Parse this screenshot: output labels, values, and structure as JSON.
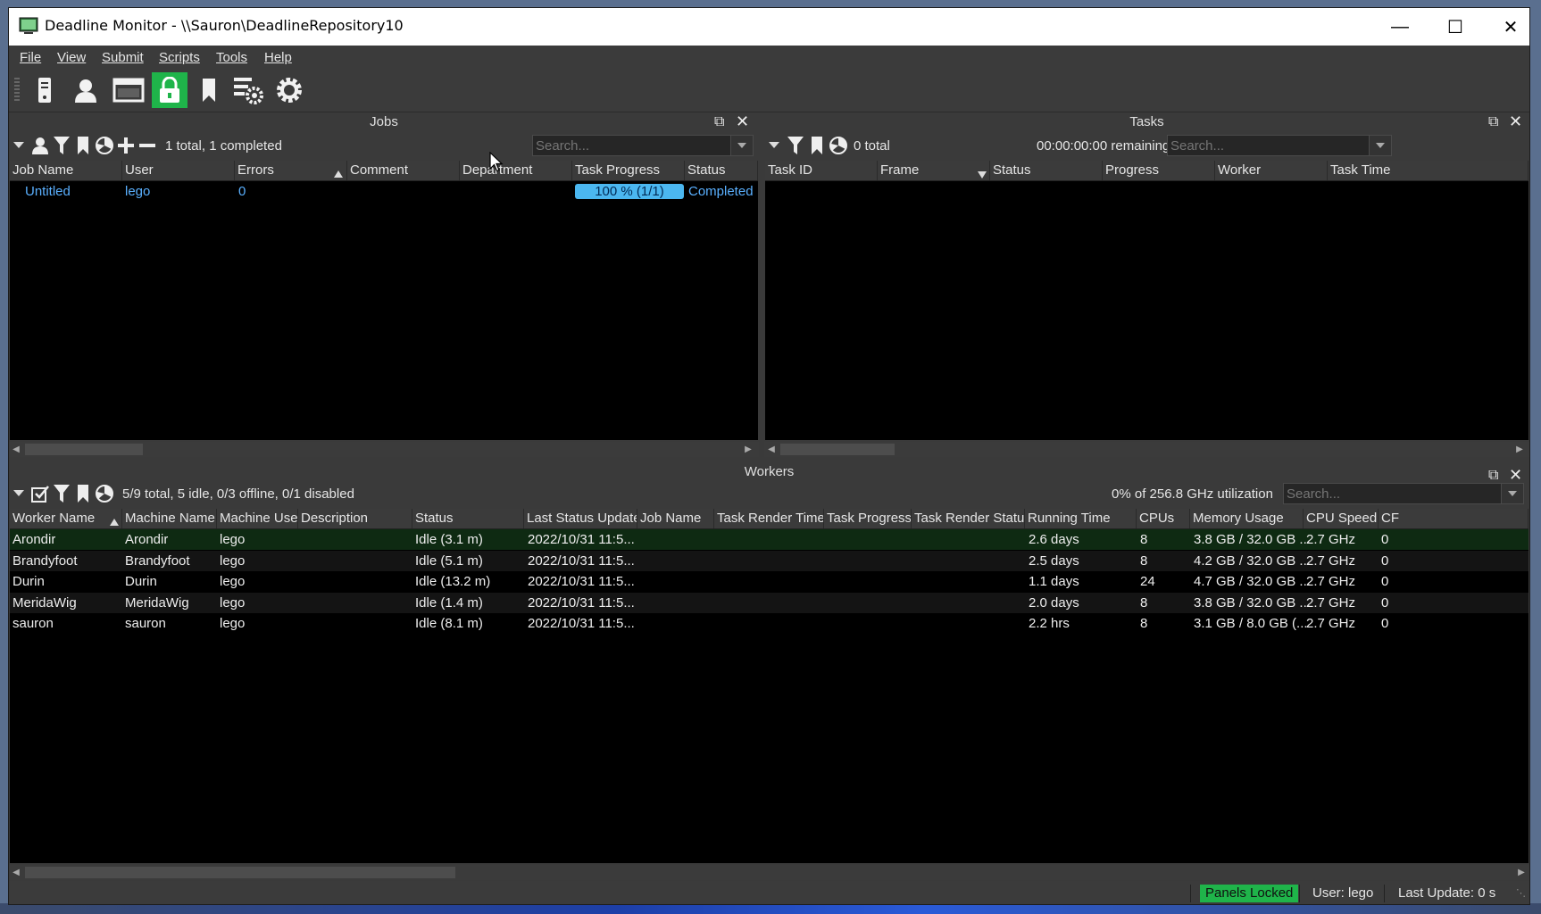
{
  "window": {
    "title": "Deadline Monitor  -  \\\\Sauron\\DeadlineRepository10"
  },
  "menu": [
    "File",
    "View",
    "Submit",
    "Scripts",
    "Tools",
    "Help"
  ],
  "toolbar_icons": [
    "worker-icon",
    "user-icon",
    "monitor-icon",
    "lock-icon",
    "bookmark-icon",
    "settings-list-icon",
    "gear-icon"
  ],
  "jobs": {
    "title": "Jobs",
    "summary": "1 total, 1 completed",
    "search_placeholder": "Search...",
    "columns": [
      "Job Name",
      "User",
      "Errors",
      "Comment",
      "Department",
      "Task Progress",
      "Status"
    ],
    "rows": [
      {
        "job_name": "Untitled",
        "user": "lego",
        "errors": "0",
        "comment": "",
        "department": "",
        "task_progress": "100 %  (1/1)",
        "progress_fraction": 1.0,
        "status": "Completed"
      }
    ]
  },
  "tasks": {
    "title": "Tasks",
    "summary": "0 total",
    "remaining": "00:00:00:00 remaining",
    "search_placeholder": "Search...",
    "columns": [
      "Task ID",
      "Frame",
      "Status",
      "Progress",
      "Worker",
      "Task Time"
    ]
  },
  "workers": {
    "title": "Workers",
    "summary": "5/9 total, 5 idle, 0/3 offline, 0/1 disabled",
    "utilization": "0% of 256.8 GHz utilization",
    "search_placeholder": "Search...",
    "columns": [
      "Worker Name",
      "Machine Name",
      "Machine User",
      "Description",
      "Status",
      "Last Status Update",
      "Job Name",
      "Task Render Time",
      "Task Progress",
      "Task Render Status",
      "Running Time",
      "CPUs",
      "Memory Usage",
      "CPU Speed",
      "CF"
    ],
    "rows": [
      {
        "name": "Arondir",
        "machine": "Arondir",
        "user": "lego",
        "status": "Idle (3.1 m)",
        "last_update": "2022/10/31 11:5...",
        "running": "2.6 days",
        "cpus": "8",
        "memory": "3.8 GB / 32.0 GB ...",
        "speed": "2.7 GHz",
        "cf": "0"
      },
      {
        "name": "Brandyfoot",
        "machine": "Brandyfoot",
        "user": "lego",
        "status": "Idle (5.1 m)",
        "last_update": "2022/10/31 11:5...",
        "running": "2.5 days",
        "cpus": "8",
        "memory": "4.2 GB / 32.0 GB ...",
        "speed": "2.7 GHz",
        "cf": "0"
      },
      {
        "name": "Durin",
        "machine": "Durin",
        "user": "lego",
        "status": "Idle (13.2 m)",
        "last_update": "2022/10/31 11:5...",
        "running": "1.1 days",
        "cpus": "24",
        "memory": "4.7 GB / 32.0 GB ...",
        "speed": "2.7 GHz",
        "cf": "0"
      },
      {
        "name": "MeridaWig",
        "machine": "MeridaWig",
        "user": "lego",
        "status": "Idle (1.4 m)",
        "last_update": "2022/10/31 11:5...",
        "running": "2.0 days",
        "cpus": "8",
        "memory": "3.8 GB / 32.0 GB ...",
        "speed": "2.7 GHz",
        "cf": "0"
      },
      {
        "name": "sauron",
        "machine": "sauron",
        "user": "lego",
        "status": "Idle (8.1 m)",
        "last_update": "2022/10/31 11:5...",
        "running": "2.2 hrs",
        "cpus": "8",
        "memory": "3.1 GB / 8.0 GB (...",
        "speed": "2.7 GHz",
        "cf": "0"
      }
    ]
  },
  "status_bar": {
    "panels_locked": "Panels Locked",
    "user": "User: lego",
    "last_update": "Last Update: 0 s"
  },
  "colors": {
    "accent_green": "#1fb44a",
    "link_blue": "#5ab0ff",
    "progress_blue": "#4bb7f0"
  }
}
